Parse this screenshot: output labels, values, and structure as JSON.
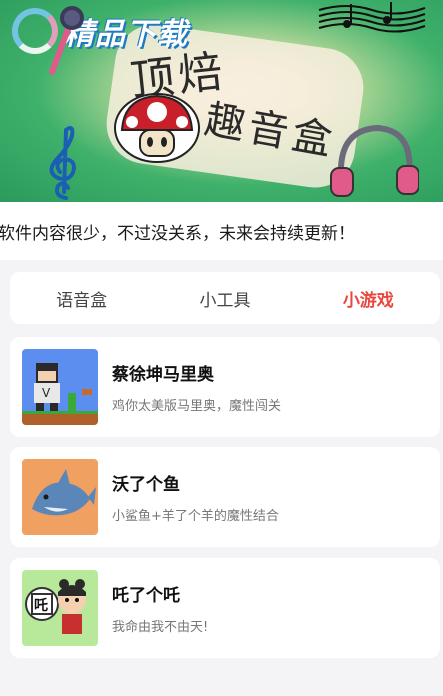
{
  "banner": {
    "watermark_text": "精品下载",
    "title_top": "顶焙",
    "title_bottom": "趣音盒",
    "icons": [
      "microphone-icon",
      "music-notes-icon",
      "treble-clef-icon",
      "mushroom-icon",
      "headphones-icon"
    ]
  },
  "notice": {
    "text": "软件内容很少，不过没关系，未来会持续更新！"
  },
  "tabs": [
    {
      "label": "语音盒",
      "active": false
    },
    {
      "label": "小工具",
      "active": false
    },
    {
      "label": "小游戏",
      "active": true
    }
  ],
  "games": [
    {
      "title": "蔡徐坤马里奥",
      "desc": "鸡你太美版马里奥，魔性闯关",
      "icon": "mario-game-icon"
    },
    {
      "title": "沃了个鱼",
      "desc": "小鲨鱼+羊了个羊的魔性结合",
      "icon": "shark-game-icon"
    },
    {
      "title": "吒了个吒",
      "desc": "我命由我不由天!",
      "icon": "nezha-game-icon",
      "thumb_badge": "吒"
    }
  ],
  "colors": {
    "accent": "#e8483f",
    "page_bg": "#f4f4f6",
    "card_bg": "#ffffff",
    "banner_green": "#3fb16b"
  }
}
